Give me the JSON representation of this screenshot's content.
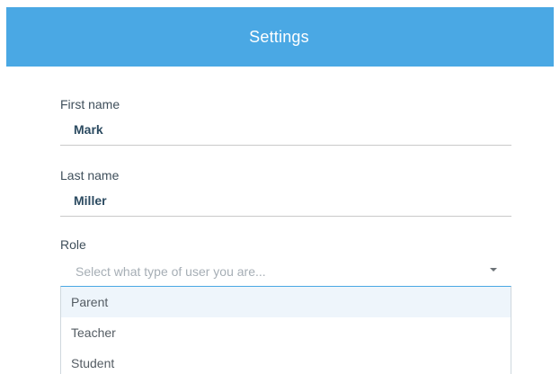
{
  "header": {
    "title": "Settings"
  },
  "form": {
    "first_name": {
      "label": "First name",
      "value": "Mark"
    },
    "last_name": {
      "label": "Last name",
      "value": "Miller"
    },
    "role": {
      "label": "Role",
      "placeholder": "Select what type of user you are...",
      "options": [
        {
          "label": "Parent",
          "highlighted": true
        },
        {
          "label": "Teacher",
          "highlighted": false
        },
        {
          "label": "Student",
          "highlighted": false
        }
      ],
      "caret_icon": "chevron-down-icon"
    }
  },
  "colors": {
    "header_bg": "#4aa8e4",
    "value_text": "#2c4b61",
    "placeholder_text": "#a6aeb5",
    "highlight_bg": "#eef5fb"
  }
}
